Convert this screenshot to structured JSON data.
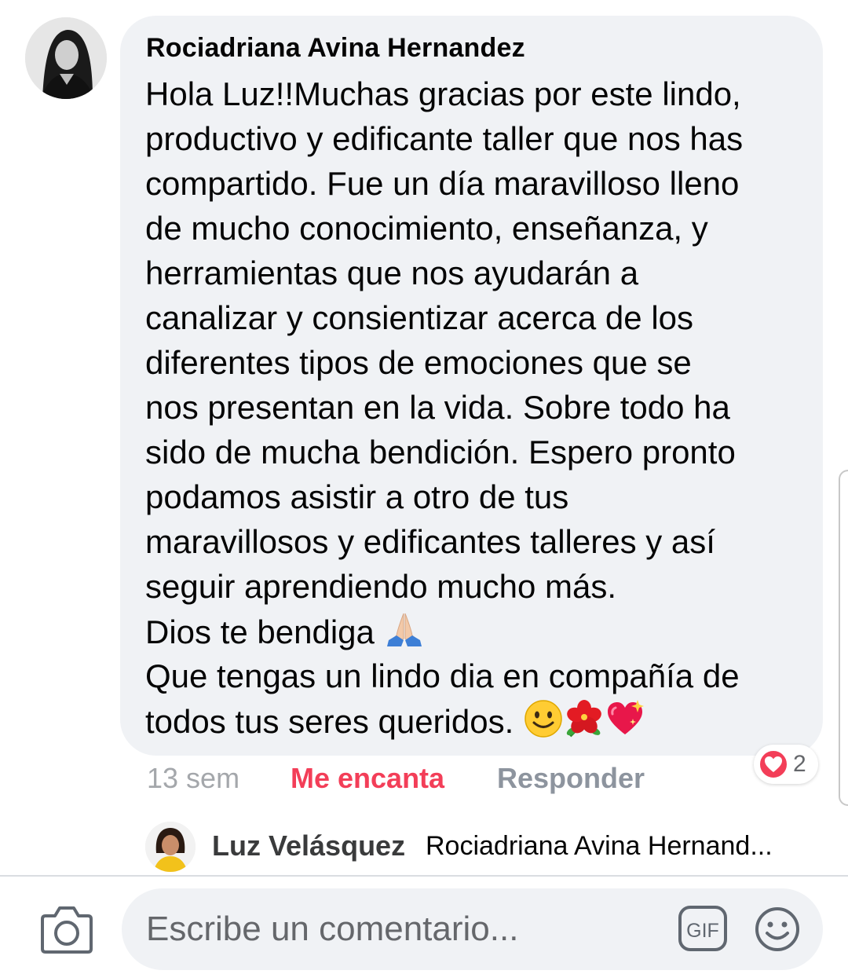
{
  "comment": {
    "author": "Rociadriana Avina Hernandez",
    "lines": [
      "Hola Luz!!Muchas gracias  por este lindo,",
      "productivo y edificante taller que nos has",
      "compartido. Fue un día maravilloso lleno",
      "de mucho conocimiento, enseñanza, y",
      "herramientas que nos ayudarán a",
      "canalizar y consientizar acerca de los",
      "diferentes tipos de emociones que se",
      "nos presentan en la vida. Sobre todo ha",
      "sido de mucha bendición. Espero pronto",
      "podamos asistir a otro de tus",
      "maravillosos y edificantes talleres y así",
      "seguir aprendiendo mucho más.",
      "Dios te bendiga",
      "Que tengas un lindo dia en compañía de",
      "todos tus seres queridos."
    ],
    "emojis": [
      "folded-hands-icon",
      "smiley-icon",
      "hibiscus-icon",
      "sparkling-heart-icon"
    ],
    "actions": {
      "time": "13 sem",
      "reaction": "Me encanta",
      "reply": "Responder"
    },
    "reaction_count": "2"
  },
  "reply_preview": {
    "author": "Luz Velásquez",
    "text": "Rociadriana Avina Hernand..."
  },
  "composer": {
    "placeholder": "Escribe un comentario..."
  },
  "colors": {
    "bubble": "#f0f2f5",
    "love": "#f33e58",
    "muted": "#8d949e"
  }
}
